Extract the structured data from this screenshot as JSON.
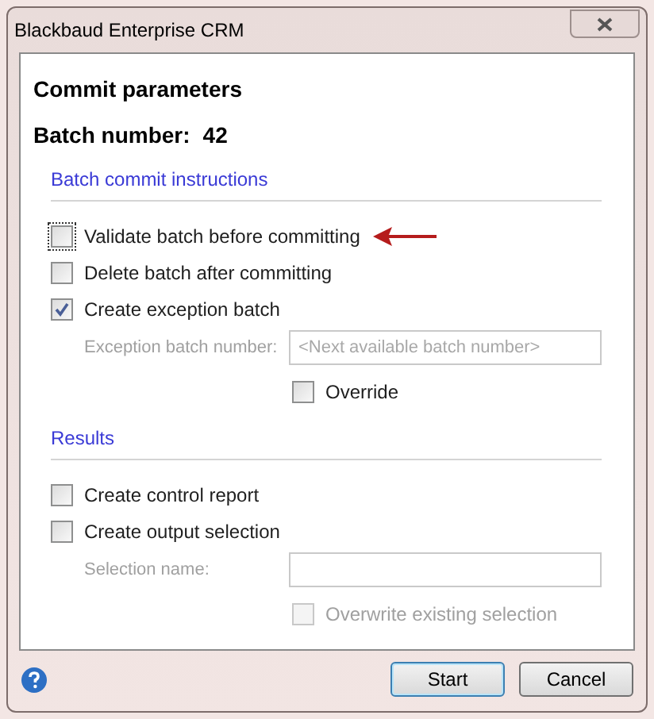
{
  "window": {
    "title": "Blackbaud Enterprise CRM"
  },
  "heading": "Commit parameters",
  "batch": {
    "label": "Batch number:",
    "value": "42"
  },
  "sections": [
    {
      "title": "Batch commit instructions",
      "items": [
        {
          "kind": "checkbox",
          "label": "Validate batch before committing",
          "checked": false,
          "disabled": false,
          "focused": true,
          "annotated": true
        },
        {
          "kind": "checkbox",
          "label": "Delete batch after committing",
          "checked": false,
          "disabled": false,
          "focused": false,
          "annotated": false
        },
        {
          "kind": "checkbox",
          "label": "Create exception batch",
          "checked": true,
          "disabled": false,
          "focused": false,
          "annotated": false
        },
        {
          "kind": "field",
          "label": "Exception batch number:",
          "placeholder": "<Next available batch number>"
        },
        {
          "kind": "option",
          "label": "Override",
          "checked": false,
          "disabled": false,
          "focused": false,
          "annotated": false
        }
      ]
    },
    {
      "title": "Results",
      "items": [
        {
          "kind": "checkbox",
          "label": "Create control report",
          "checked": false,
          "disabled": false,
          "focused": false,
          "annotated": false
        },
        {
          "kind": "checkbox",
          "label": "Create output selection",
          "checked": false,
          "disabled": false,
          "focused": false,
          "annotated": false
        },
        {
          "kind": "field",
          "label": "Selection name:"
        },
        {
          "kind": "option",
          "label": "Overwrite existing selection",
          "checked": false,
          "disabled": true,
          "focused": false,
          "annotated": false
        }
      ]
    }
  ],
  "buttons": [
    {
      "label": "Start",
      "default": true
    },
    {
      "label": "Cancel",
      "default": false
    }
  ]
}
